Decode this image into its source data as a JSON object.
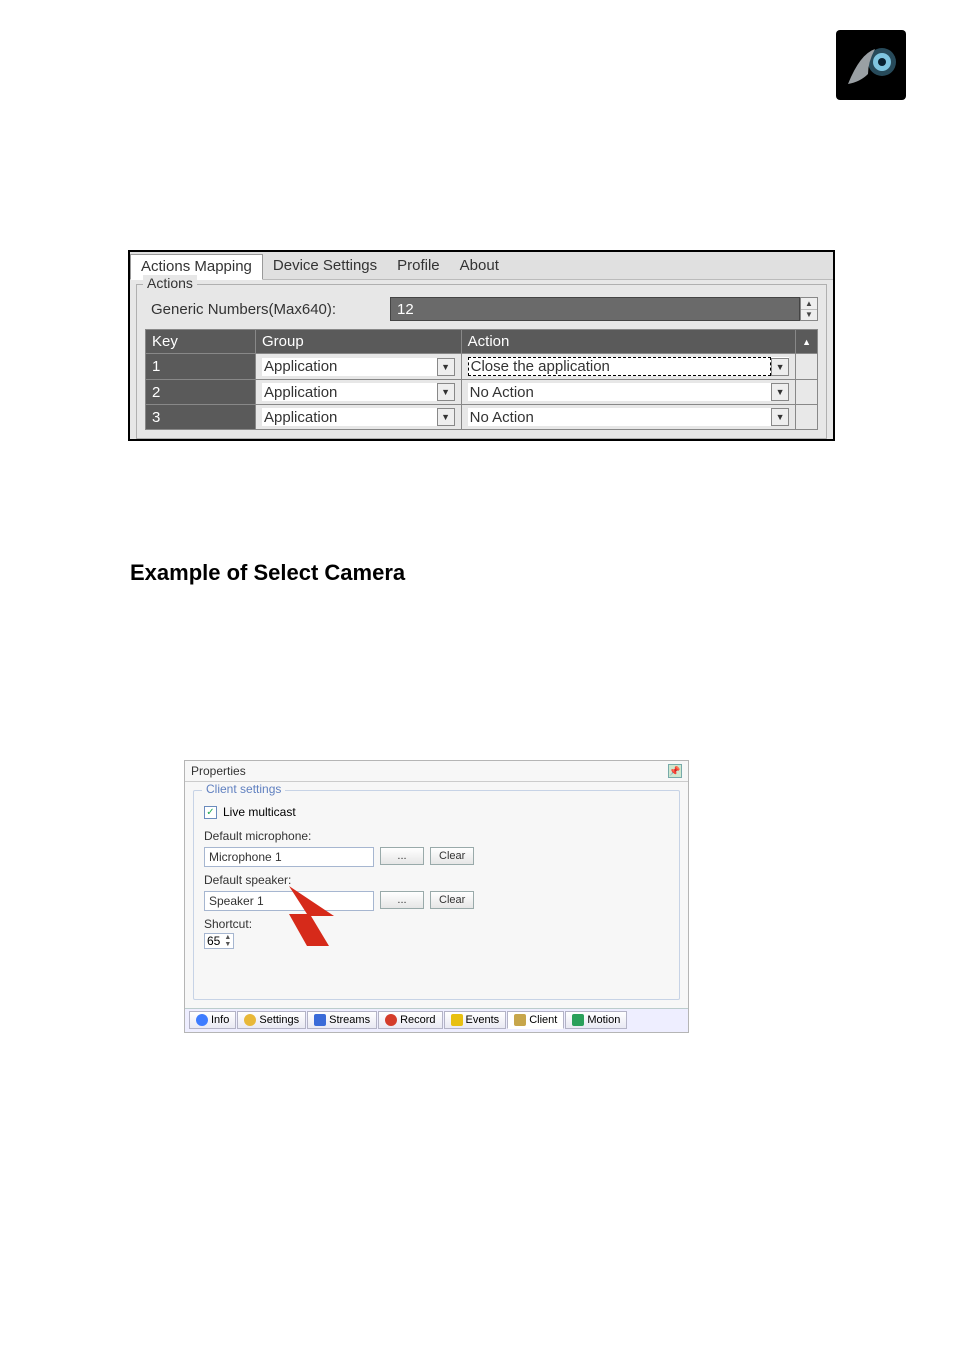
{
  "logo": {
    "name": "wolf-eye-logo"
  },
  "panel1": {
    "tabs": [
      "Actions Mapping",
      "Device Settings",
      "Profile",
      "About"
    ],
    "active_tab_index": 0,
    "groupbox_title": "Actions",
    "generic_label": "Generic Numbers(Max640):",
    "generic_value": "12",
    "columns": [
      "Key",
      "Group",
      "Action"
    ],
    "rows": [
      {
        "key": "1",
        "group": "Application",
        "action": "Close the application",
        "action_focused": true
      },
      {
        "key": "2",
        "group": "Application",
        "action": "No Action",
        "action_focused": false
      },
      {
        "key": "3",
        "group": "Application",
        "action": "No Action",
        "action_focused": false
      }
    ]
  },
  "heading": "Example of Select Camera",
  "panel2": {
    "title": "Properties",
    "group_legend": "Client settings",
    "live_multicast": {
      "label": "Live multicast",
      "checked": true
    },
    "default_mic_label": "Default microphone:",
    "default_mic_value": "Microphone 1",
    "default_speaker_label": "Default speaker:",
    "default_speaker_value": "Speaker 1",
    "browse_label": "...",
    "clear_label": "Clear",
    "shortcut_label": "Shortcut:",
    "shortcut_value": "65",
    "tabs": [
      {
        "label": "Info",
        "icon": "info"
      },
      {
        "label": "Settings",
        "icon": "settings"
      },
      {
        "label": "Streams",
        "icon": "streams"
      },
      {
        "label": "Record",
        "icon": "record"
      },
      {
        "label": "Events",
        "icon": "events"
      },
      {
        "label": "Client",
        "icon": "client"
      },
      {
        "label": "Motion",
        "icon": "motion"
      }
    ],
    "active_tab_index": 5
  }
}
